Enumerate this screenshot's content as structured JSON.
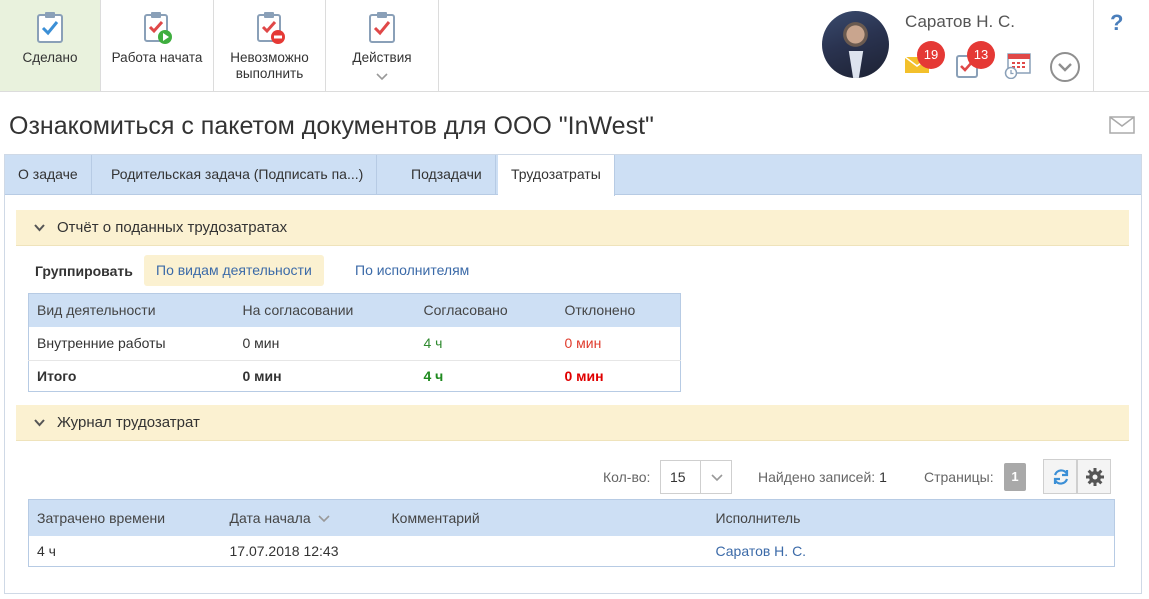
{
  "toolbar": {
    "done_label": "Сделано",
    "start_label": "Работа начата",
    "impossible_label": "Невозможно выполнить",
    "actions_label": "Действия"
  },
  "user": {
    "name": "Саратов Н. С.",
    "mail_count": "19",
    "task_count": "13"
  },
  "help_label": "?",
  "page": {
    "title": "Ознакомиться с пакетом документов для ООО \"InWest\""
  },
  "tabs": [
    {
      "label": "О задаче"
    },
    {
      "label": "Родительская задача (Подписать па...)"
    },
    {
      "label": "Подзадачи"
    },
    {
      "label": "Трудозатраты"
    }
  ],
  "report": {
    "title": "Отчёт о поданных трудозатратах",
    "group_label": "Группировать",
    "group_options": [
      "По видам деятельности",
      "По исполнителям"
    ],
    "columns": [
      "Вид деятельности",
      "На согласовании",
      "Согласовано",
      "Отклонено"
    ],
    "rows": [
      {
        "activity": "Внутренние работы",
        "pending": "0 мин",
        "approved": "4 ч",
        "rejected": "0 мин"
      }
    ],
    "total": {
      "activity": "Итого",
      "pending": "0 мин",
      "approved": "4 ч",
      "rejected": "0 мин"
    }
  },
  "journal": {
    "title": "Журнал трудозатрат",
    "qty_label": "Кол-во:",
    "qty_value": "15",
    "found_label": "Найдено записей:",
    "found_value": "1",
    "pages_label": "Страницы:",
    "page_number": "1",
    "columns": [
      "Затрачено времени",
      "Дата начала",
      "Комментарий",
      "Исполнитель"
    ],
    "rows": [
      {
        "spent": "4 ч",
        "start": "17.07.2018 12:43",
        "comment": "",
        "executor": "Саратов Н. С."
      }
    ]
  },
  "colors": {
    "accent_blue": "#3b6aa8",
    "header_blue": "#cddff4",
    "section_yellow": "#fbf1d1",
    "approved_green": "#2f8a2f",
    "rejected_red": "#e03b2c",
    "badge_red": "#e53935"
  },
  "icons": [
    "done-check-icon",
    "start-work-icon",
    "impossible-icon",
    "actions-icon",
    "mail-icon",
    "tasks-icon",
    "calendar-icon",
    "more-icon",
    "envelope-icon",
    "refresh-icon",
    "gear-icon"
  ]
}
